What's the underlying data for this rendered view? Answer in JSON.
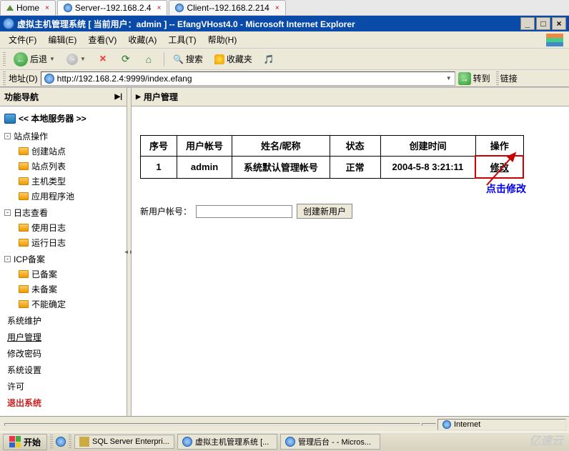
{
  "top_tabs": {
    "home": "Home",
    "server": "Server--192.168.2.4",
    "client": "Client--192.168.2.214"
  },
  "title_bar": {
    "text": "虚拟主机管理系统 [ 当前用户：admin ] -- EfangVHost4.0 - Microsoft Internet Explorer"
  },
  "menu": {
    "file": "文件(F)",
    "edit": "编辑(E)",
    "view": "查看(V)",
    "fav": "收藏(A)",
    "tools": "工具(T)",
    "help": "帮助(H)"
  },
  "toolbar": {
    "back": "后退",
    "search": "搜索",
    "favorites": "收藏夹"
  },
  "address_bar": {
    "label": "地址(D)",
    "url": "http://192.168.2.4:9999/index.efang",
    "go": "转到",
    "links": "链接"
  },
  "sidebar": {
    "header": "功能导航",
    "server_label": "<< 本地服务器 >>",
    "groups": {
      "site": {
        "label": "站点操作",
        "children": [
          "创建站点",
          "站点列表",
          "主机类型",
          "应用程序池"
        ]
      },
      "logs": {
        "label": "日志查看",
        "children": [
          "使用日志",
          "运行日志"
        ]
      },
      "icp": {
        "label": "ICP备案",
        "children": [
          "已备案",
          "未备案",
          "不能确定"
        ]
      }
    },
    "links": {
      "sysmaint": "系统维护",
      "usermgmt": "用户管理",
      "changepw": "修改密码",
      "sysset": "系统设置",
      "license": "许可",
      "exit": "退出系统"
    }
  },
  "main": {
    "header": "用户管理",
    "table": {
      "headers": [
        "序号",
        "用户帐号",
        "姓名/昵称",
        "状态",
        "创建时间",
        "操作"
      ],
      "row": {
        "seq": "1",
        "account": "admin",
        "name": "系统默认管理帐号",
        "status": "正常",
        "created": "2004-5-8 3:21:11",
        "action": "修改"
      }
    },
    "new_user": {
      "label": "新用户帐号：",
      "button": "创建新用户"
    },
    "annotation": "点击修改"
  },
  "status_bar": {
    "internet": "Internet"
  },
  "taskbar": {
    "start": "开始",
    "items": [
      "SQL Server Enterpri...",
      "虚拟主机管理系统 [...",
      "管理后台 - - Micros..."
    ]
  },
  "watermark": "亿速云"
}
